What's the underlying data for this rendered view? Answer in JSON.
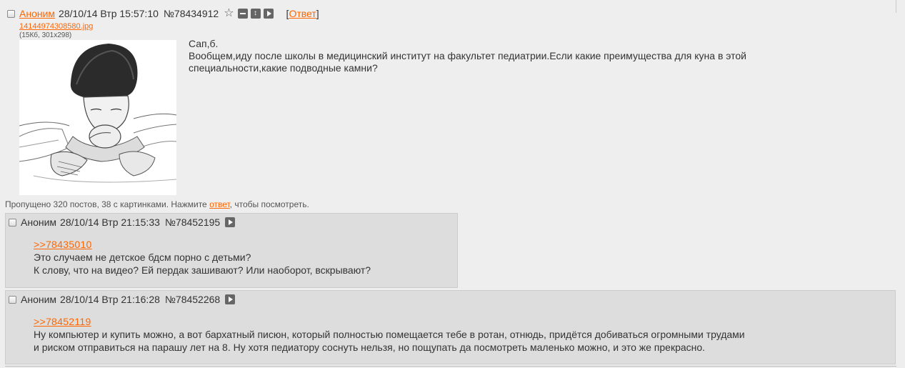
{
  "op": {
    "name": "Аноним",
    "datetime": "28/10/14 Втр 15:57:10",
    "post_number": "№78434912",
    "star_glyph": "☆",
    "reply_open": "[",
    "reply_label": "Ответ",
    "reply_close": "]",
    "file_name": "14144974308580.jpg",
    "file_info": "(15Кб, 301x298)",
    "image_icon": "drawing-of-person-performing-infant-cpr",
    "text_lines": [
      "Сап,б.",
      "Вообщем,иду после школы в медицинский институт на факультет педиатрии.Если какие преимущества для куна в этой",
      "специальности,какие подводные камни?"
    ]
  },
  "omitted": {
    "prefix": "Пропущено 320 постов, 38 с картинками. Нажмите ",
    "link": "ответ",
    "suffix": ", чтобы посмотреть."
  },
  "replies": [
    {
      "name": "Аноним",
      "datetime": "28/10/14 Втр 21:15:33",
      "post_number": "№78452195",
      "ref": ">>78435010",
      "lines": [
        "Это случаем не детское бдсм порно с детьми?",
        "К слову, что на видео? Ей пердак зашивают? Или наоборот, вскрывают?"
      ]
    },
    {
      "name": "Аноним",
      "datetime": "28/10/14 Втр 21:16:28",
      "post_number": "№78452268",
      "ref": ">>78452119",
      "lines": [
        "Ну компьютер и купить можно, а вот бархатный писюн, который полностью помещается тебе в ротан, отнюдь, придётся добиваться огромными трудами",
        "и риском отправиться на парашу лет на 8. Ну хотя педиатору соснуть нельзя, но пощупать да посмотреть маленько можно, и это же прекрасно."
      ]
    }
  ],
  "colors": {
    "background": "#eeeeee",
    "reply_background": "#dddddd",
    "link": "#ff6600",
    "text": "#333333",
    "icon": "#666666"
  }
}
